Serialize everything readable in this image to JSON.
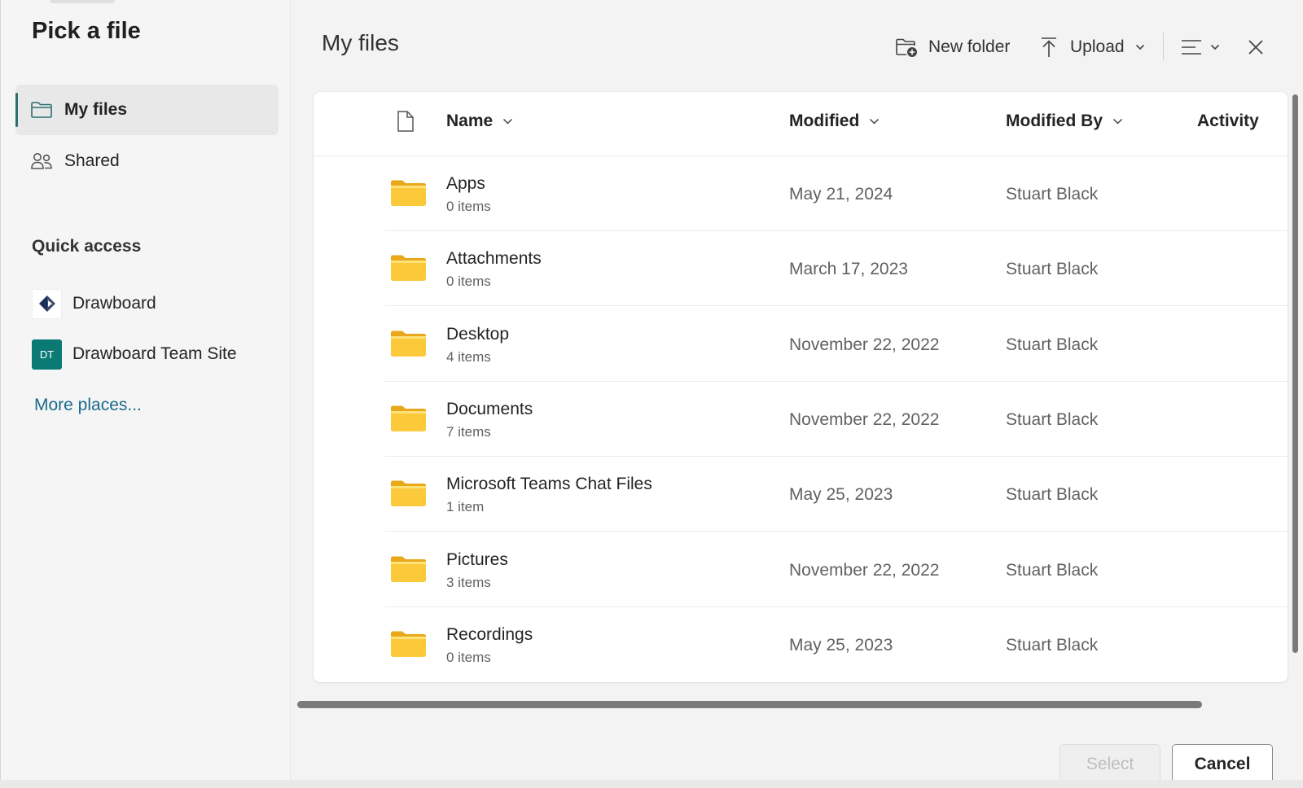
{
  "sidebar": {
    "title": "Pick a file",
    "nav": [
      {
        "label": "My files",
        "icon": "folder-icon",
        "active": true
      },
      {
        "label": "Shared",
        "icon": "people-icon",
        "active": false
      }
    ],
    "quick_access_label": "Quick access",
    "quick_access": [
      {
        "label": "Drawboard",
        "icon": "drawboard-logo-icon"
      },
      {
        "label": "Drawboard Team Site",
        "icon_text": "DT",
        "icon": "site-initials-icon"
      }
    ],
    "more_places": "More places..."
  },
  "main": {
    "title": "My files",
    "toolbar": {
      "new_folder": "New folder",
      "upload": "Upload"
    },
    "columns": {
      "name": "Name",
      "modified": "Modified",
      "modified_by": "Modified By",
      "activity": "Activity"
    },
    "rows": [
      {
        "name": "Apps",
        "count": "0 items",
        "modified": "May 21, 2024",
        "modified_by": "Stuart Black"
      },
      {
        "name": "Attachments",
        "count": "0 items",
        "modified": "March 17, 2023",
        "modified_by": "Stuart Black"
      },
      {
        "name": "Desktop",
        "count": "4 items",
        "modified": "November 22, 2022",
        "modified_by": "Stuart Black"
      },
      {
        "name": "Documents",
        "count": "7 items",
        "modified": "November 22, 2022",
        "modified_by": "Stuart Black"
      },
      {
        "name": "Microsoft Teams Chat Files",
        "count": "1 item",
        "modified": "May 25, 2023",
        "modified_by": "Stuart Black"
      },
      {
        "name": "Pictures",
        "count": "3 items",
        "modified": "November 22, 2022",
        "modified_by": "Stuart Black"
      },
      {
        "name": "Recordings",
        "count": "0 items",
        "modified": "May 25, 2023",
        "modified_by": "Stuart Black"
      }
    ]
  },
  "footer": {
    "select": "Select",
    "cancel": "Cancel"
  },
  "colors": {
    "accent": "#2b6f6f",
    "link": "#1a6a8a",
    "folder": "#f8c42f",
    "site_badge": "#0b7a75"
  }
}
